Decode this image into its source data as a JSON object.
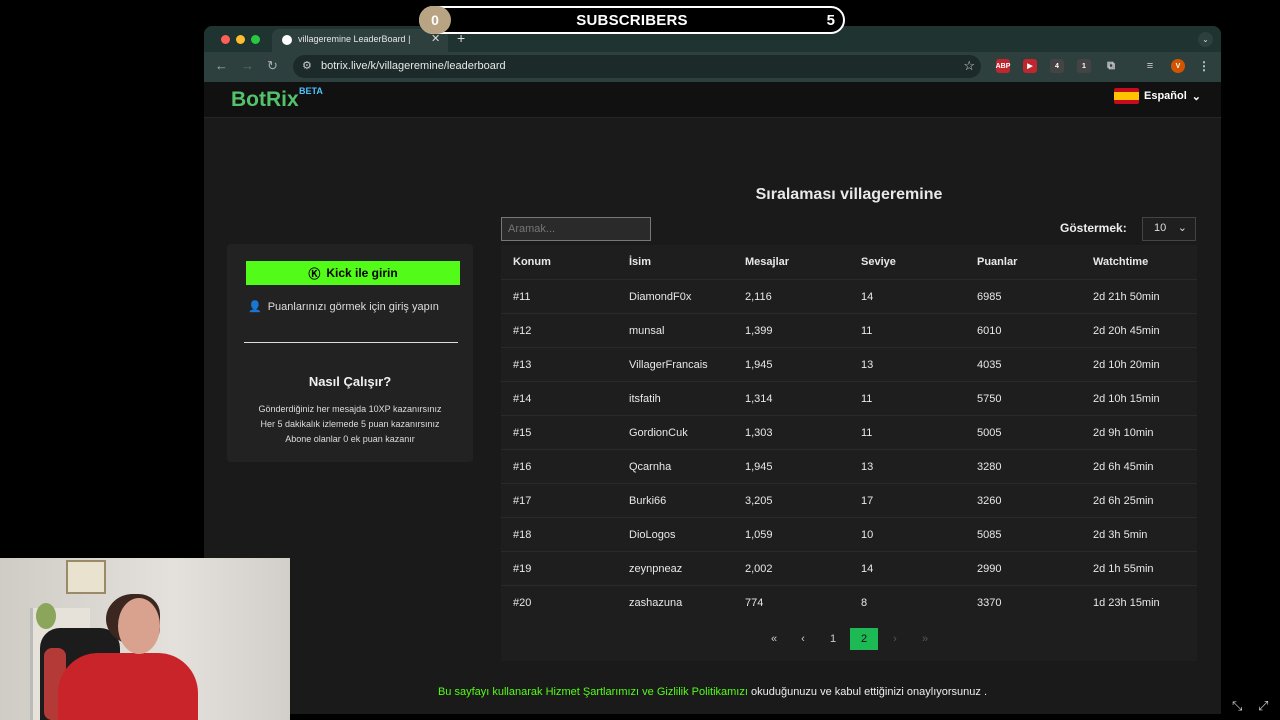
{
  "overlay": {
    "count": "0",
    "label": "SUBSCRIBERS",
    "goal": "5"
  },
  "browser": {
    "tab_title": "villageremine LeaderBoard |",
    "url": "botrix.live/k/villageremine/leaderboard",
    "extensions": [
      "ABP",
      "▶",
      "4",
      "1"
    ],
    "profile_initial": "V"
  },
  "site": {
    "logo": "BotRix",
    "logo_badge": "BETA",
    "language": "Español"
  },
  "leaderboard": {
    "heading": "Sıralaması villageremine",
    "search_placeholder": "Aramak...",
    "show_label": "Göstermek:",
    "show_value": "10",
    "columns": [
      "Konum",
      "İsim",
      "Mesajlar",
      "Seviye",
      "Puanlar",
      "Watchtime"
    ],
    "rows": [
      [
        "#11",
        "DiamondF0x",
        "2,116",
        "14",
        "6985",
        "2d 21h 50min"
      ],
      [
        "#12",
        "munsal",
        "1,399",
        "11",
        "6010",
        "2d 20h 45min"
      ],
      [
        "#13",
        "VillagerFrancais",
        "1,945",
        "13",
        "4035",
        "2d 10h 20min"
      ],
      [
        "#14",
        "itsfatih",
        "1,314",
        "11",
        "5750",
        "2d 10h 15min"
      ],
      [
        "#15",
        "GordionCuk",
        "1,303",
        "11",
        "5005",
        "2d 9h 10min"
      ],
      [
        "#16",
        "Qcarnha",
        "1,945",
        "13",
        "3280",
        "2d 6h 45min"
      ],
      [
        "#17",
        "Burki66",
        "3,205",
        "17",
        "3260",
        "2d 6h 25min"
      ],
      [
        "#18",
        "DioLogos",
        "1,059",
        "10",
        "5085",
        "2d 3h 5min"
      ],
      [
        "#19",
        "zeynpneaz",
        "2,002",
        "14",
        "2990",
        "2d 1h 55min"
      ],
      [
        "#20",
        "zashazuna",
        "774",
        "8",
        "3370",
        "1d 23h 15min"
      ]
    ],
    "pagination": {
      "first": "«",
      "prev": "‹",
      "pages": [
        "1",
        "2"
      ],
      "current": "2",
      "next": "›",
      "last": "»"
    }
  },
  "sidebar": {
    "kick_button": "Kick ile girin",
    "login_hint": "Puanlarınızı görmek için giriş yapın",
    "how_title": "Nasıl Çalışır?",
    "rules": [
      "Gönderdiğiniz her mesajda 10XP kazanırsınız",
      "Her 5 dakikalık izlemede 5 puan kazanırsınız",
      "Abone olanlar 0 ek puan kazanır"
    ]
  },
  "footer": {
    "prefix": "Bu sayfayı kullanarak",
    "terms_link": "Hizmet Şartlarımızı",
    "conj": "ve",
    "privacy_link": "Gizlilik Politikamızı",
    "suffix": "okuduğunuzu ve kabul ettiğinizi onaylıyorsunuz ."
  },
  "colors": {
    "accent": "#53fc18",
    "brand": "#53c26b",
    "page_bg": "#1a1a1a"
  }
}
